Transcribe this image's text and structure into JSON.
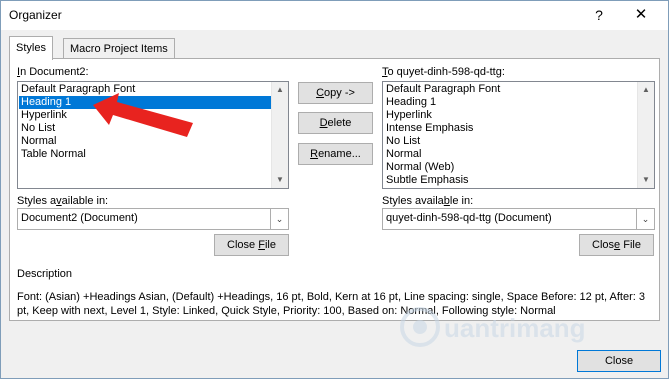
{
  "window": {
    "title": "Organizer",
    "help_glyph": "?",
    "close_glyph": "✕"
  },
  "tabs": [
    {
      "label": "Styles",
      "active": true
    },
    {
      "label": "Macro Project Items",
      "active": false
    }
  ],
  "left": {
    "label_prefix": "I",
    "label_rest": "n Document2:",
    "items": [
      "Default Paragraph Font",
      "Heading 1",
      "Hyperlink",
      "No List",
      "Normal",
      "Table Normal"
    ],
    "selected_index": 1,
    "available_label_pre": "Styles a",
    "available_label_u": "v",
    "available_label_post": "ailable in:",
    "available_value": "Document2 (Document)",
    "close_file_pre": "Close ",
    "close_file_u": "F",
    "close_file_post": "ile"
  },
  "right": {
    "label_pre": "T",
    "label_rest": "o quyet-dinh-598-qd-ttg:",
    "items": [
      "Default Paragraph Font",
      "Heading 1",
      "Hyperlink",
      "Intense Emphasis",
      "No List",
      "Normal",
      "Normal (Web)",
      "Subtle Emphasis"
    ],
    "available_label_pre": "Styles availa",
    "available_label_u": "b",
    "available_label_post": "le in:",
    "available_value": "quyet-dinh-598-qd-ttg (Document)",
    "close_file_pre": "Clos",
    "close_file_u": "e",
    "close_file_post": " File"
  },
  "middle": {
    "copy_u": "C",
    "copy_rest": "opy ->",
    "delete_u": "D",
    "delete_rest": "elete",
    "rename_u": "R",
    "rename_rest": "ename..."
  },
  "description": {
    "label": "Description",
    "text": "Font: (Asian) +Headings Asian, (Default) +Headings, 16 pt, Bold, Kern at 16 pt, Line spacing: single, Space Before: 12 pt, After: 3 pt, Keep with next, Level 1, Style: Linked, Quick Style, Priority: 100, Based on: Normal, Following style: Normal"
  },
  "footer": {
    "close_label": "Close"
  },
  "watermark": "uantrimang",
  "colors": {
    "selection": "#0078d7",
    "annotation_arrow": "#e8231f",
    "dialog_bg": "#f0f0f0"
  },
  "icons": {
    "scroll_up": "▲",
    "scroll_down": "▼",
    "combo_arrow": "⌄"
  }
}
